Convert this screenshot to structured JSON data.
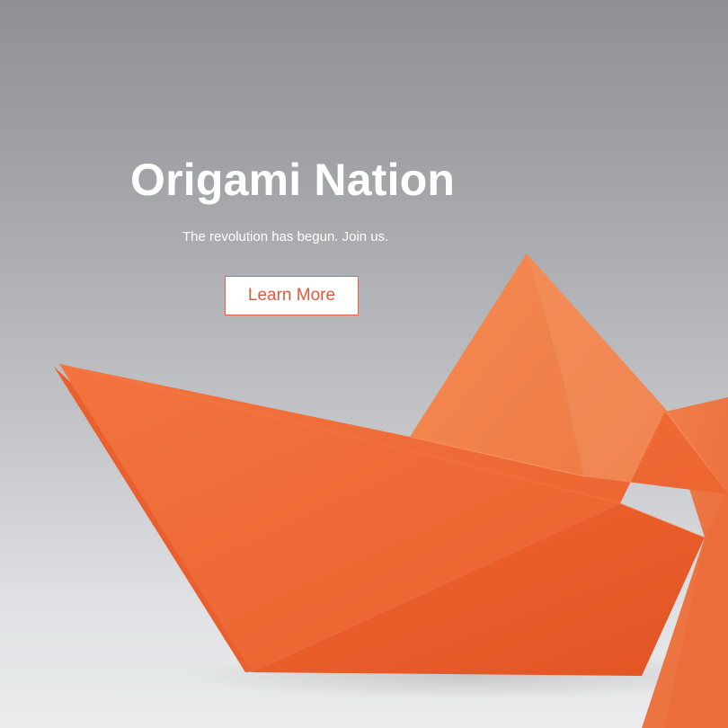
{
  "hero": {
    "title": "Origami Nation",
    "subtitle": "The revolution has begun. Join us.",
    "cta_label": "Learn More"
  },
  "colors": {
    "boat_orange": "#f06a35",
    "cta_border": "#e8644a",
    "title_text": "#ffffff"
  },
  "image": {
    "subject": "orange-paper-boat"
  }
}
